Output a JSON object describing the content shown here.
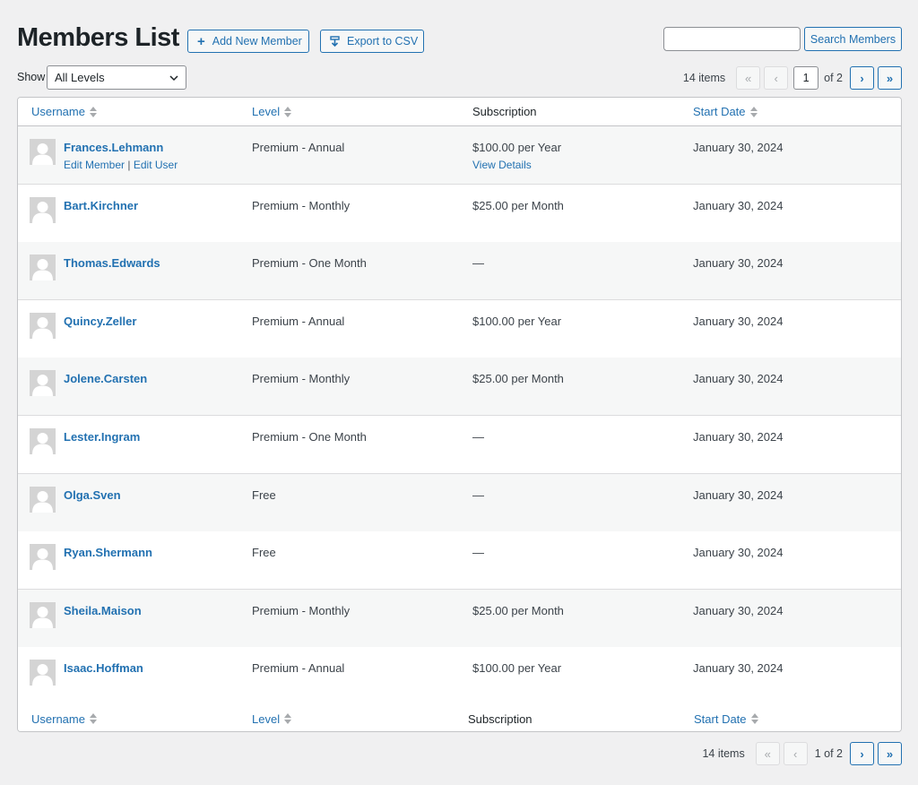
{
  "header": {
    "title": "Members List",
    "add_new_label": "Add New Member",
    "export_label": "Export to CSV",
    "search_value": "",
    "search_button": "Search Members"
  },
  "filter": {
    "show_label": "Show",
    "selected_level": "All Levels"
  },
  "pagination_top": {
    "items": "14 items",
    "first": "«",
    "prev": "‹",
    "current_page": "1",
    "of_total": "of 2",
    "next": "›",
    "last": "»"
  },
  "pagination_bottom": {
    "items": "14 items",
    "first": "«",
    "prev": "‹",
    "page_text": "1 of 2",
    "next": "›",
    "last": "»"
  },
  "columns": {
    "username": "Username",
    "level": "Level",
    "subscription": "Subscription",
    "start_date": "Start Date"
  },
  "row_actions": {
    "edit_member": "Edit Member",
    "separator": "|",
    "edit_user": "Edit User",
    "view_details": "View Details"
  },
  "members": [
    {
      "username": "Frances.Lehmann",
      "level": "Premium - Annual",
      "subscription": "$100.00 per Year",
      "start_date": "January 30, 2024"
    },
    {
      "username": "Bart.Kirchner",
      "level": "Premium - Monthly",
      "subscription": "$25.00 per Month",
      "start_date": "January 30, 2024"
    },
    {
      "username": "Thomas.Edwards",
      "level": "Premium - One Month",
      "subscription": "—",
      "start_date": "January 30, 2024"
    },
    {
      "username": "Quincy.Zeller",
      "level": "Premium - Annual",
      "subscription": "$100.00 per Year",
      "start_date": "January 30, 2024"
    },
    {
      "username": "Jolene.Carsten",
      "level": "Premium - Monthly",
      "subscription": "$25.00 per Month",
      "start_date": "January 30, 2024"
    },
    {
      "username": "Lester.Ingram",
      "level": "Premium - One Month",
      "subscription": "—",
      "start_date": "January 30, 2024"
    },
    {
      "username": "Olga.Sven",
      "level": "Free",
      "subscription": "—",
      "start_date": "January 30, 2024"
    },
    {
      "username": "Ryan.Shermann",
      "level": "Free",
      "subscription": "—",
      "start_date": "January 30, 2024"
    },
    {
      "username": "Sheila.Maison",
      "level": "Premium - Monthly",
      "subscription": "$25.00 per Month",
      "start_date": "January 30, 2024"
    },
    {
      "username": "Isaac.Hoffman",
      "level": "Premium - Annual",
      "subscription": "$100.00 per Year",
      "start_date": "January 30, 2024"
    }
  ],
  "icons": {
    "add": "plus-icon",
    "export": "download-icon",
    "sort": "sort-arrows-icon",
    "select": "chevron-down-icon",
    "avatar": "default-avatar-icon"
  },
  "colors": {
    "accent": "#2271b1",
    "background": "#f0f0f1",
    "row_alt": "#f6f7f7"
  }
}
